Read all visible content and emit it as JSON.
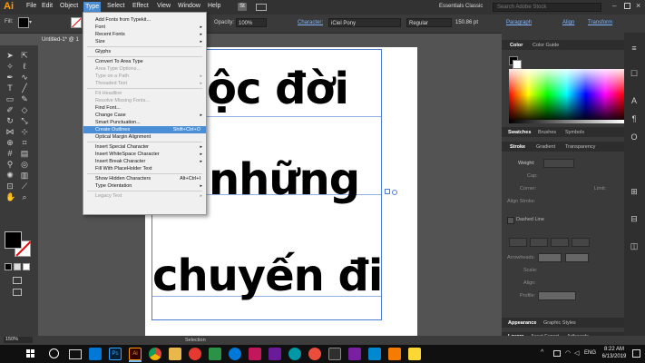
{
  "app": {
    "logo": "Ai",
    "menus": [
      "File",
      "Edit",
      "Object",
      "Type",
      "Select",
      "Effect",
      "View",
      "Window",
      "Help"
    ],
    "workspace": "Essentials Classic",
    "search_placeholder": "Search Adobe Stock"
  },
  "control_bar": {
    "opacity_label": "Opacity:",
    "opacity_value": "100%",
    "character_label": "Character:",
    "font_name": "iCiel Pony",
    "font_style": "Regular",
    "font_size": "150.86 pt",
    "paragraph_label": "Paragraph",
    "align_label": "Align",
    "transform_label": "Transform"
  },
  "document": {
    "tab_title": "Untitled-1* @ 1",
    "zoom": "150%",
    "status_tool": "Selection"
  },
  "artwork": {
    "line1": "ộc đời",
    "line2": "những",
    "line3": "chuyến đi"
  },
  "type_menu": {
    "items": [
      {
        "label": "Add Fonts from Typekit...",
        "shortcut": "",
        "submenu": false,
        "disabled": false
      },
      {
        "label": "Font",
        "shortcut": "",
        "submenu": true,
        "disabled": false
      },
      {
        "label": "Recent Fonts",
        "shortcut": "",
        "submenu": true,
        "disabled": false
      },
      {
        "label": "Size",
        "shortcut": "",
        "submenu": true,
        "disabled": false
      },
      {
        "sep": true
      },
      {
        "label": "Glyphs",
        "shortcut": "",
        "submenu": false,
        "disabled": false
      },
      {
        "sep": true
      },
      {
        "label": "Convert To Area Type",
        "shortcut": "",
        "submenu": false,
        "disabled": false
      },
      {
        "label": "Area Type Options...",
        "shortcut": "",
        "submenu": false,
        "disabled": true
      },
      {
        "label": "Type on a Path",
        "shortcut": "",
        "submenu": true,
        "disabled": true
      },
      {
        "label": "Threaded Text",
        "shortcut": "",
        "submenu": true,
        "disabled": true
      },
      {
        "sep": true
      },
      {
        "label": "Fit Headline",
        "shortcut": "",
        "submenu": false,
        "disabled": true
      },
      {
        "label": "Resolve Missing Fonts...",
        "shortcut": "",
        "submenu": false,
        "disabled": true
      },
      {
        "label": "Find Font...",
        "shortcut": "",
        "submenu": false,
        "disabled": false
      },
      {
        "label": "Change Case",
        "shortcut": "",
        "submenu": true,
        "disabled": false
      },
      {
        "label": "Smart Punctuation...",
        "shortcut": "",
        "submenu": false,
        "disabled": false
      },
      {
        "label": "Create Outlines",
        "shortcut": "Shift+Ctrl+O",
        "submenu": false,
        "disabled": false,
        "highlight": true
      },
      {
        "label": "Optical Margin Alignment",
        "shortcut": "",
        "submenu": false,
        "disabled": false
      },
      {
        "sep": true
      },
      {
        "label": "Insert Special Character",
        "shortcut": "",
        "submenu": true,
        "disabled": false
      },
      {
        "label": "Insert WhiteSpace Character",
        "shortcut": "",
        "submenu": true,
        "disabled": false
      },
      {
        "label": "Insert Break Character",
        "shortcut": "",
        "submenu": true,
        "disabled": false
      },
      {
        "label": "Fill With PlaceHolder Text",
        "shortcut": "",
        "submenu": false,
        "disabled": false
      },
      {
        "sep": true
      },
      {
        "label": "Show Hidden Characters",
        "shortcut": "Alt+Ctrl+I",
        "submenu": false,
        "disabled": false
      },
      {
        "label": "Type Orientation",
        "shortcut": "",
        "submenu": true,
        "disabled": false
      },
      {
        "sep": true
      },
      {
        "label": "Legacy Text",
        "shortcut": "",
        "submenu": true,
        "disabled": true
      }
    ]
  },
  "panels": {
    "color_tabs": [
      "Color",
      "Color Guide"
    ],
    "swatch_tabs": [
      "Swatches",
      "Brushes",
      "Symbols"
    ],
    "stroke_tabs": [
      "Stroke",
      "Gradient",
      "Transparency"
    ],
    "weight_label": "Weight:",
    "cap_label": "Cap:",
    "corner_label": "Corner:",
    "limit_label": "Limit:",
    "align_stroke_label": "Align Stroke:",
    "dashed_line_label": "Dashed Line",
    "arrowheads_label": "Arrowheads:",
    "scale_label": "Scale:",
    "align_label": "Align:",
    "profile_label": "Profile:",
    "appearance_tabs": [
      "Appearance",
      "Graphic Styles"
    ],
    "layers_tabs": [
      "Layers",
      "Asset Export",
      "Artboards"
    ]
  },
  "taskbar": {
    "time": "8:22 AM",
    "date": "6/13/2019",
    "language": "ENG",
    "colors": {
      "accent": "#4b8ed6",
      "illustrator": "#ff9a00"
    }
  }
}
